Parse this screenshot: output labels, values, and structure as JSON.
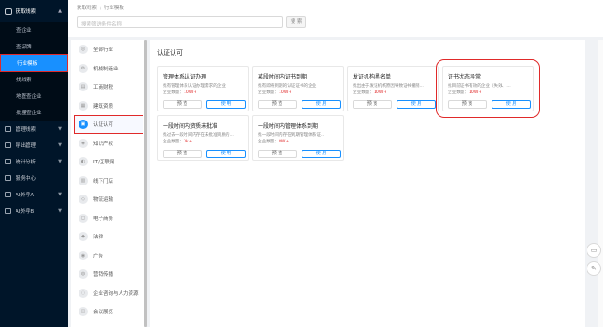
{
  "sidebar": {
    "group": {
      "label": "获取线索"
    },
    "sub_items": [
      {
        "label": "查企业"
      },
      {
        "label": "查品牌"
      },
      {
        "label": "行业模板"
      },
      {
        "label": "找线索"
      },
      {
        "label": "地图查企业"
      },
      {
        "label": "批量查企业"
      }
    ],
    "items": [
      {
        "label": "管理线索"
      },
      {
        "label": "导出管理"
      },
      {
        "label": "统计分析"
      },
      {
        "label": "服务中心"
      },
      {
        "label": "AI外呼A"
      },
      {
        "label": "AI外呼B"
      }
    ]
  },
  "breadcrumb": {
    "root": "获取线索",
    "sep": "/",
    "current": "行业模板"
  },
  "search": {
    "placeholder": "搜索筛选条件名称",
    "button": "搜 索"
  },
  "industries": [
    {
      "label": "全部行业"
    },
    {
      "label": "机械制造业"
    },
    {
      "label": "工商财税"
    },
    {
      "label": "建筑资质"
    },
    {
      "label": "认证认可"
    },
    {
      "label": "知识产权"
    },
    {
      "label": "IT/互联网"
    },
    {
      "label": "线下门店"
    },
    {
      "label": "物流运输"
    },
    {
      "label": "电子商务"
    },
    {
      "label": "法律"
    },
    {
      "label": "广告"
    },
    {
      "label": "营销传播"
    },
    {
      "label": "企业咨询与人力资源"
    },
    {
      "label": "会议展览"
    }
  ],
  "content": {
    "title": "认证认可",
    "count_label": "企业数量：",
    "preview_label": "预 览",
    "use_label": "使 用",
    "cards": [
      {
        "title": "管理体系认证办理",
        "desc": "找有管理体系认证办理需求的企业",
        "count": "10W+"
      },
      {
        "title": "某段时间内证书到期",
        "desc": "找有即将到期的认证证书的企业",
        "count": "10W+"
      },
      {
        "title": "发证机构黑名单",
        "desc": "找出由于发证机构原因导致证书撤销...",
        "count": "10W+"
      },
      {
        "title": "证书状态异常",
        "desc": "找目前证书有效的企业（失效、...",
        "count": "10W+"
      },
      {
        "title": "一段时间内资质未批准",
        "desc": "找过去一段时间内存在未批准资质的...",
        "count": "3k+"
      },
      {
        "title": "一段时间内管理体系到期",
        "desc": "找一段时间内存在到期管理体系证...",
        "count": "8W+"
      }
    ]
  }
}
